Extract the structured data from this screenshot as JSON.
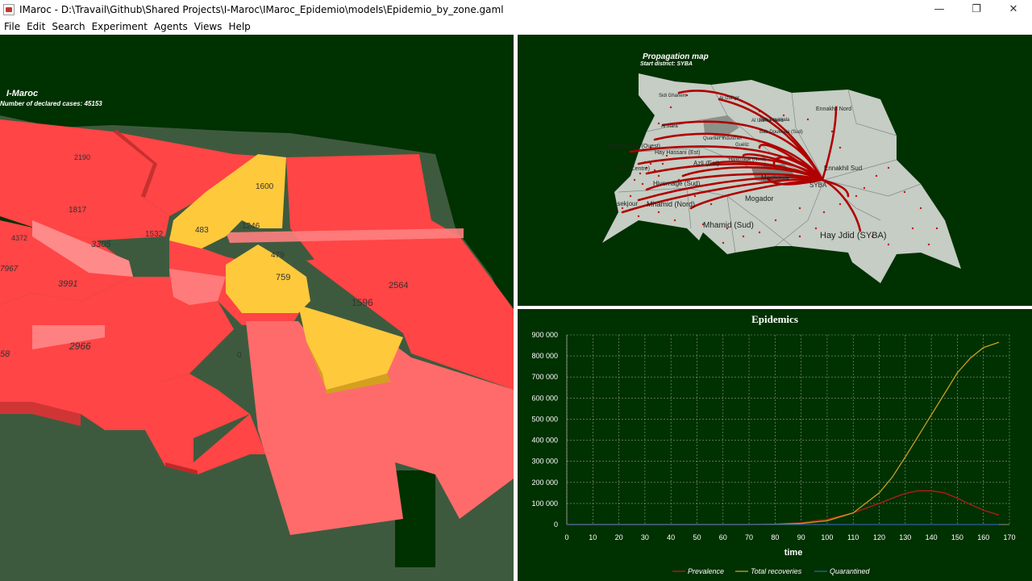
{
  "window": {
    "title": "IMaroc - D:\\Travail\\Github\\Shared Projects\\I-Maroc\\IMaroc_Epidemio\\models\\Epidemio_by_zone.gaml",
    "minimize": "—",
    "maximize": "❐",
    "close": "✕"
  },
  "menu": [
    "File",
    "Edit",
    "Search",
    "Experiment",
    "Agents",
    "Views",
    "Help"
  ],
  "left_view": {
    "title": "I-Maroc",
    "subtitle": "Number of declared cases: 45153",
    "zone_labels": [
      "2190",
      "1817",
      "1532",
      "1600",
      "483",
      "1246",
      "479",
      "759",
      "2564",
      "1596",
      "3305",
      "3991",
      "7967",
      "2966",
      "4372",
      "58",
      "0"
    ]
  },
  "right_view": {
    "title": "Propagation map",
    "subtitle": "Start district: SYBA",
    "districts": [
      "Ennakhil Nord",
      "Ennakhil Sud",
      "Al Izdihar",
      "Hay Hassani (Ouest)",
      "Hay Hassani (Est)",
      "Azli (Centre)",
      "Azli (Est)",
      "Quartier Industriel",
      "Guéliz",
      "Mechouar",
      "SYBA",
      "Mogador",
      "Mhamid (Nord)",
      "Mhamid (Sud)",
      "Hivernage (Sud)",
      "Hivernage (Nord)",
      "Asekjour",
      "Hay Jdid (SYBA)",
      "Sidi Ghanem",
      "Al Izdihar Nord",
      "Al Inara",
      "Bab Doukkala",
      "Bab Doukkala (Sud)"
    ]
  },
  "chart_data": {
    "type": "line",
    "title": "Epidemics",
    "xlabel": "time",
    "ylabel": "",
    "xlim": [
      0,
      170
    ],
    "ylim": [
      0,
      900000
    ],
    "x_ticks": [
      0,
      10,
      20,
      30,
      40,
      50,
      60,
      70,
      80,
      90,
      100,
      110,
      120,
      130,
      140,
      150,
      160,
      170
    ],
    "y_ticks": [
      0,
      100000,
      200000,
      300000,
      400000,
      500000,
      600000,
      700000,
      800000,
      900000
    ],
    "y_tick_labels": [
      "0",
      "100 000",
      "200 000",
      "300 000",
      "400 000",
      "500 000",
      "600 000",
      "700 000",
      "800 000",
      "900 000"
    ],
    "grid": true,
    "legend_position": "bottom",
    "x": [
      0,
      70,
      80,
      90,
      100,
      110,
      120,
      125,
      130,
      135,
      140,
      145,
      150,
      155,
      160,
      166
    ],
    "series": [
      {
        "name": "Prevalence",
        "color": "#b71c1c",
        "values": [
          0,
          0,
          2000,
          8000,
          25000,
          55000,
          100000,
          125000,
          148000,
          160000,
          160000,
          150000,
          125000,
          95000,
          68000,
          45000
        ]
      },
      {
        "name": "Total recoveries",
        "color": "#c8a020",
        "values": [
          0,
          0,
          1000,
          5000,
          18000,
          55000,
          150000,
          225000,
          320000,
          420000,
          520000,
          620000,
          720000,
          790000,
          840000,
          865000
        ]
      },
      {
        "name": "Quarantined",
        "color": "#3060a0",
        "values": [
          0,
          0,
          0,
          0,
          0,
          0,
          0,
          0,
          0,
          0,
          0,
          0,
          0,
          0,
          0,
          0
        ]
      }
    ]
  }
}
